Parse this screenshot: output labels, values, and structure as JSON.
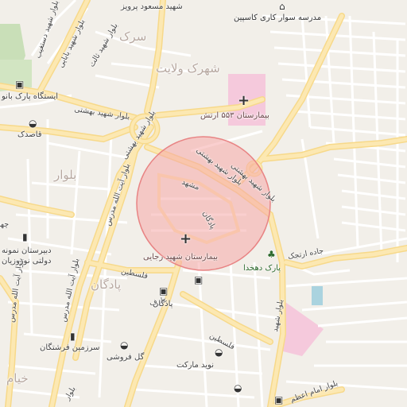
{
  "map": {
    "area_labels": {
      "sarak": "سرک",
      "shahrak_velayat": "شهرک ولایت",
      "bolvar": "بلوار",
      "padegan": "پادگان",
      "kheyam": "خیام"
    },
    "roads": {
      "shahid_beheshti_1": "بلوار شهید بهشتی",
      "shahid_beheshti_2": "بلوار شهید بهشتی",
      "shahid_beheshti_3": "بلوار شهید بهشتی",
      "shahid_beheshti_4": "بلوار شهید بهشتی",
      "shahid_dastgheib": "بلوار شهید دستغیب",
      "shahid_babaei": "بلوار شهید بابایی",
      "shahid_sani": "بلوار شهید ثالث",
      "ayatollah_modarres_1": "بلوار آیت الله مدرس",
      "ayatollah_modarres_2": "بلوار آیت الله مدرس",
      "ayatollah_modarres_3": "بلوار آیت الله مدرس",
      "mashhad": "مشهد",
      "padegan_1": "پادگان",
      "falestin_1": "فلسطین",
      "falestin_2": "فلسطین",
      "jadeh_arjak": "جاده ارتجک",
      "bolvar_left_edge": "بلوار",
      "chaharrah": "چها",
      "shahid_farshi": "شهید",
      "sharif": "عارف",
      "bolvar_bottom": "بلوار",
      "ashraf": "بلوار شهید",
      "emam_azam": "بلوار امام اعظم"
    },
    "pois": {
      "hospital_553": "بیمارستان ۵۵۳ ارتش",
      "hospital_rajaei": "بیمارستان شهید رجایی",
      "park_dehkhoda": "پارک دهخدا",
      "park_station": "ایستگاه پارک بانو",
      "school": "مدرسه سوار کاری کاسپین",
      "masoud_parviz": "شهید مسعود پرویز",
      "ghasedak": "قاصدک",
      "dabirestan_1": "دبیرستان نمونه",
      "dabirestan_2": "دولتی نوروزیان",
      "padegan_stop": "پادگان",
      "sarzamin": "سرزمین فرشتگان",
      "gol_forooshi": "گل فروشی",
      "navid_market": "نوید مارکت"
    },
    "circle": {
      "fill": "#f5a8a8",
      "stroke": "#e88484"
    }
  }
}
